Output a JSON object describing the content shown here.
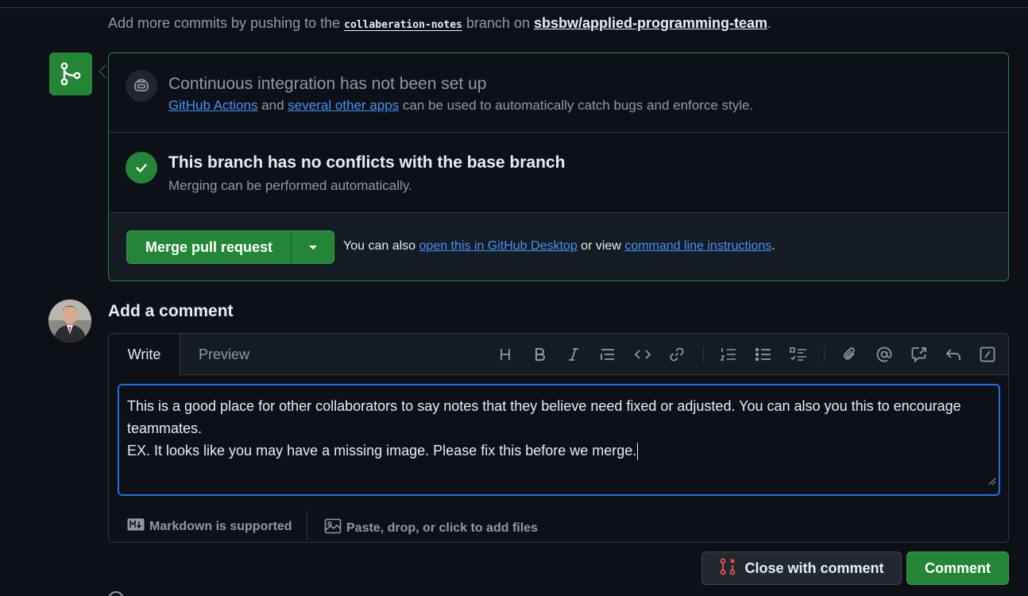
{
  "push_note": {
    "prefix": "Add more commits by pushing to the",
    "branch": "collaberation-notes",
    "middle": "branch on",
    "repo": "sbsbw/applied-programming-team",
    "suffix": "."
  },
  "ci": {
    "title": "Continuous integration has not been set up",
    "link1": "GitHub Actions",
    "and": "and",
    "link2": "several other apps",
    "rest": "can be used to automatically catch bugs and enforce style."
  },
  "conflicts": {
    "title": "This branch has no conflicts with the base branch",
    "desc": "Merging can be performed automatically."
  },
  "merge": {
    "button_label": "Merge pull request",
    "alt_prefix": "You can also",
    "alt_link1": "open this in GitHub Desktop",
    "alt_middle": "or view",
    "alt_link2": "command line instructions",
    "alt_suffix": "."
  },
  "comment": {
    "title": "Add a comment",
    "tabs": [
      "Write",
      "Preview"
    ],
    "active_tab": "Write",
    "toolbar": [
      "heading-icon",
      "bold-icon",
      "italic-icon",
      "quote-icon",
      "code-icon",
      "link-icon",
      "ordered-list-icon",
      "unordered-list-icon",
      "task-list-icon",
      "attach-icon",
      "mention-icon",
      "cross-reference-icon",
      "reply-icon",
      "slash-command-icon"
    ],
    "text_line1": "This is a good place for other collaborators to say notes that they believe need fixed or adjusted. You can also you this to encourage teammates.",
    "text_line2": "EX. It looks like you may have a missing image. Please fix this before we merge.",
    "markdown_note": "Markdown is supported",
    "files_note": "Paste, drop, or click to add files"
  },
  "actions": {
    "close_label": "Close with comment",
    "comment_label": "Comment"
  },
  "colors": {
    "accent_green": "#238636",
    "link_blue": "#4493f8",
    "background": "#0d1117",
    "focus_blue": "#1f6feb"
  }
}
